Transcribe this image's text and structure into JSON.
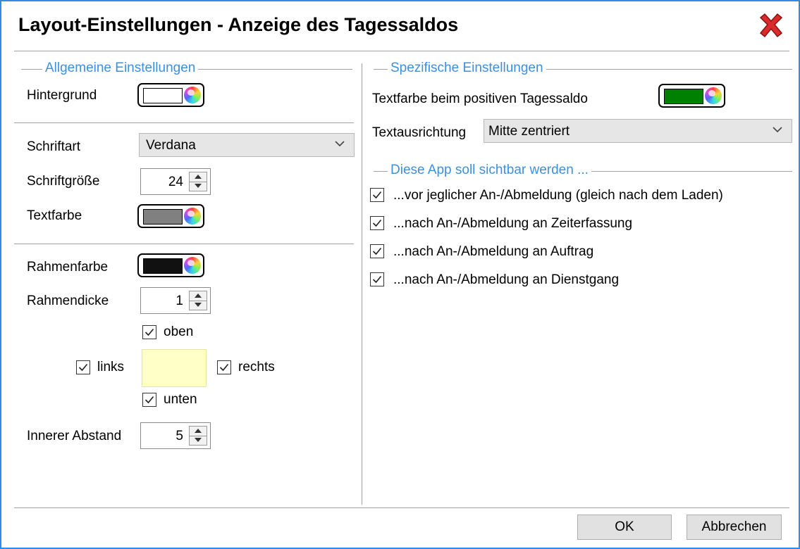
{
  "window": {
    "title": "Layout-Einstellungen - Anzeige des Tagessaldos"
  },
  "general": {
    "group_label": "Allgemeine Einstellungen",
    "background": {
      "label": "Hintergrund",
      "color": "#ffffff"
    },
    "font": {
      "label": "Schriftart",
      "value": "Verdana"
    },
    "font_size": {
      "label": "Schriftgröße",
      "value": "24"
    },
    "text_color": {
      "label": "Textfarbe",
      "color": "#808080"
    },
    "border_color": {
      "label": "Rahmenfarbe",
      "color": "#111111"
    },
    "border_width": {
      "label": "Rahmendicke",
      "value": "1"
    },
    "sides": {
      "top": "oben",
      "left": "links",
      "right": "rechts",
      "bottom": "unten",
      "preview_color": "#ffffc8"
    },
    "padding": {
      "label": "Innerer Abstand",
      "value": "5"
    }
  },
  "specific": {
    "group_label": "Spezifische Einstellungen",
    "positive_color": {
      "label": "Textfarbe beim positiven Tagessaldo",
      "color": "#008000"
    },
    "alignment": {
      "label": "Textausrichtung",
      "value": "Mitte zentriert"
    }
  },
  "visibility": {
    "group_label": "Diese App soll sichtbar werden ...",
    "options": [
      "...vor jeglicher An-/Abmeldung (gleich nach dem Laden)",
      "...nach An-/Abmeldung an Zeiterfassung",
      "...nach An-/Abmeldung an Auftrag",
      "...nach An-/Abmeldung an Dienstgang"
    ]
  },
  "footer": {
    "ok": "OK",
    "cancel": "Abbrechen"
  }
}
